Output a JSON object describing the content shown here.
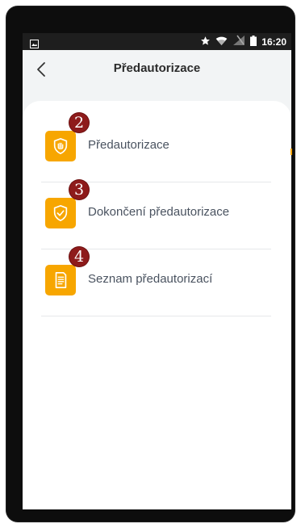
{
  "status_bar": {
    "time": "16:20",
    "icons": [
      "image-icon",
      "star-icon",
      "wifi-icon",
      "signal-icon",
      "battery-icon"
    ]
  },
  "header": {
    "title": "Předautorizace",
    "back_icon": "chevron-left-icon"
  },
  "menu": {
    "items": [
      {
        "label": "Předautorizace",
        "badge": "2",
        "icon": "shield-hand-icon"
      },
      {
        "label": "Dokončení předautorizace",
        "badge": "3",
        "icon": "shield-check-icon"
      },
      {
        "label": "Seznam předautorizací",
        "badge": "4",
        "icon": "document-list-icon"
      }
    ]
  },
  "colors": {
    "accent": "#f7a600",
    "badge": "#8e1b1b",
    "header_bg": "#f2f4f5",
    "text": "#4a5360"
  }
}
